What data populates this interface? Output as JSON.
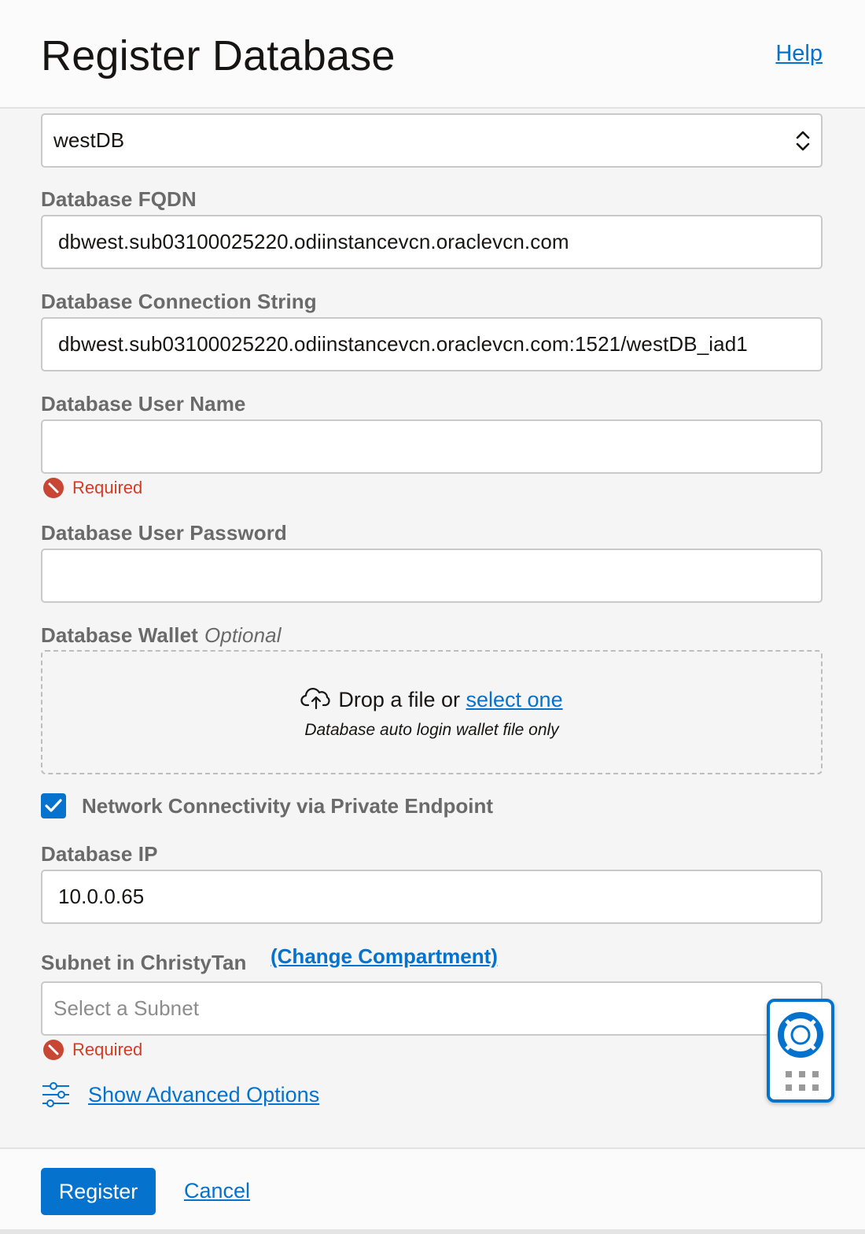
{
  "header": {
    "title": "Register Database",
    "help_label": "Help"
  },
  "form": {
    "database_select": {
      "value": "westDB"
    },
    "fqdn": {
      "label": "Database FQDN",
      "value": "dbwest.sub03100025220.odiinstancevcn.oraclevcn.com"
    },
    "connection_string": {
      "label": "Database Connection String",
      "value": "dbwest.sub03100025220.odiinstancevcn.oraclevcn.com:1521/westDB_iad1"
    },
    "user_name": {
      "label": "Database User Name",
      "value": "",
      "error": "Required"
    },
    "user_password": {
      "label": "Database User Password",
      "value": ""
    },
    "wallet": {
      "label": "Database Wallet",
      "optional": "Optional",
      "drop_text": "Drop a file or",
      "select_link": "select one",
      "hint": "Database auto login wallet file only"
    },
    "private_endpoint": {
      "label": "Network Connectivity via Private Endpoint",
      "checked": true
    },
    "database_ip": {
      "label": "Database IP",
      "value": "10.0.0.65"
    },
    "subnet": {
      "label_prefix": "Subnet in",
      "compartment": "ChristyTan",
      "change_link": "(Change Compartment)",
      "placeholder": "Select a Subnet",
      "error": "Required"
    },
    "advanced_link": "Show Advanced Options"
  },
  "footer": {
    "register_label": "Register",
    "cancel_label": "Cancel"
  },
  "colors": {
    "accent": "#0572ce",
    "error": "#d63b25",
    "label": "#6a6a6a"
  },
  "icons": [
    "updown-icon",
    "error-icon",
    "cloud-upload-icon",
    "checkmark-icon",
    "sliders-icon",
    "lifebuoy-icon",
    "grip-icon"
  ]
}
